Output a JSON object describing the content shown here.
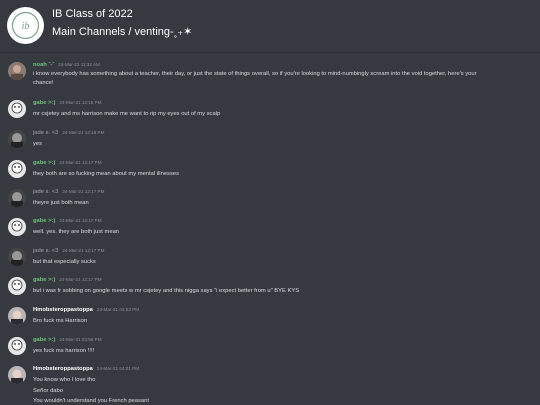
{
  "header": {
    "server_name": "IB Class of 2022",
    "channel_path": "Main Channels / venting-˳₊✶"
  },
  "messages": [
    {
      "author": "noah ˆ-ˆ",
      "timestamp": "24-Mar-21 11:32 AM",
      "author_color": "#71c07f",
      "avatar": "photo-avatar",
      "lines": [
        "i know everybody has something about a teacher, their day, or just the state of things overall, so if you're looking to mind-numbingly scream into the void together, here's your",
        "chance!"
      ]
    },
    {
      "author": "gabe >:)",
      "timestamp": "24-Mar-21 12:16 PM",
      "author_color": "#71c07f",
      "avatar": "cartoon-avatar",
      "lines": [
        "mr csjetey and ms harrison make me want to rip my eyes out of my scalp"
      ]
    },
    {
      "author": "jade s. <3",
      "timestamp": "24-Mar-21 12:16 PM",
      "author_color": "#a3a6aa",
      "avatar": "bw-avatar",
      "lines": [
        "yes"
      ]
    },
    {
      "author": "gabe >:)",
      "timestamp": "24-Mar-21 12:17 PM",
      "author_color": "#71c07f",
      "avatar": "cartoon-avatar",
      "lines": [
        "they both are so fucking mean about my mental illnesses"
      ]
    },
    {
      "author": "jade s. <3",
      "timestamp": "24-Mar-21 12:17 PM",
      "author_color": "#a3a6aa",
      "avatar": "bw-avatar",
      "lines": [
        "theyre just both mean"
      ]
    },
    {
      "author": "gabe >:)",
      "timestamp": "24-Mar-21 12:17 PM",
      "author_color": "#71c07f",
      "avatar": "cartoon-avatar",
      "lines": [
        "well. yes. they are both just mean"
      ]
    },
    {
      "author": "jade s. <3",
      "timestamp": "24-Mar-21 12:17 PM",
      "author_color": "#a3a6aa",
      "avatar": "bw-avatar",
      "lines": [
        "but that especially sucks"
      ]
    },
    {
      "author": "gabe >:)",
      "timestamp": "24-Mar-21 12:17 PM",
      "author_color": "#71c07f",
      "avatar": "cartoon-avatar",
      "lines": [
        "but i was fr sobbing on google meets w mr csjetey and this nigga says \"i expect better from u\" BYE KYS"
      ]
    },
    {
      "author": "Hmobsteroppastoppa",
      "timestamp": "24-Mar-21 03:53 PM",
      "author_color": "#ffffff",
      "avatar": "photo-avatar-2",
      "lines": [
        "Bro fuck ms Harrison"
      ]
    },
    {
      "author": "gabe >:)",
      "timestamp": "24-Mar-21 03:56 PM",
      "author_color": "#71c07f",
      "avatar": "cartoon-avatar",
      "lines": [
        "yes fuck ms harrison !!!!"
      ]
    },
    {
      "author": "Hmobsteroppastoppa",
      "timestamp": "24-Mar-21 04:01 PM",
      "author_color": "#ffffff",
      "avatar": "photo-avatar-2",
      "lines": [
        "You know who I love tho",
        "Señor dabo",
        "You wouldn't understand you French peasant"
      ]
    }
  ]
}
